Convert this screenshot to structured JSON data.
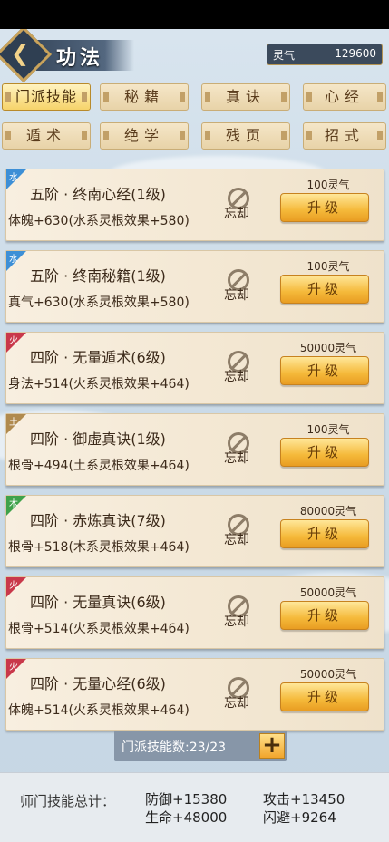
{
  "header": {
    "title": "功法",
    "qi_label": "灵气",
    "qi_value": "129600"
  },
  "tabs": [
    {
      "label": "门派技能",
      "active": true
    },
    {
      "label": "秘籍"
    },
    {
      "label": "真诀"
    },
    {
      "label": "心经"
    },
    {
      "label": "遁术"
    },
    {
      "label": "绝学"
    },
    {
      "label": "残页"
    },
    {
      "label": "招式"
    }
  ],
  "skills": [
    {
      "element": "水",
      "color": "#3d8fd6",
      "name": "五阶 · 终南心经(1级)",
      "desc": "体魄+630(水系灵根效果+580)",
      "cost": "100灵气"
    },
    {
      "element": "水",
      "color": "#3d8fd6",
      "name": "五阶 · 终南秘籍(1级)",
      "desc": "真气+630(水系灵根效果+580)",
      "cost": "100灵气"
    },
    {
      "element": "火",
      "color": "#c9384a",
      "name": "四阶 · 无量遁术(6级)",
      "desc": "身法+514(火系灵根效果+464)",
      "cost": "50000灵气"
    },
    {
      "element": "土",
      "color": "#b08a4e",
      "name": "四阶 · 御虚真诀(1级)",
      "desc": "根骨+494(土系灵根效果+464)",
      "cost": "100灵气"
    },
    {
      "element": "木",
      "color": "#3fa24a",
      "name": "四阶 · 赤炼真诀(7级)",
      "desc": "根骨+518(木系灵根效果+464)",
      "cost": "80000灵气"
    },
    {
      "element": "火",
      "color": "#c9384a",
      "name": "四阶 · 无量真诀(6级)",
      "desc": "根骨+514(火系灵根效果+464)",
      "cost": "50000灵气"
    },
    {
      "element": "火",
      "color": "#c9384a",
      "name": "四阶 · 无量心经(6级)",
      "desc": "体魄+514(火系灵根效果+464)",
      "cost": "50000灵气"
    }
  ],
  "common": {
    "forget_label": "忘却",
    "upgrade_label": "升级"
  },
  "footer": {
    "count": "门派技能数:23/23",
    "summary_label": "师门技能总计：",
    "stats": [
      "防御+15380",
      "攻击+13450",
      "生命+48000",
      "闪避+9264"
    ]
  }
}
